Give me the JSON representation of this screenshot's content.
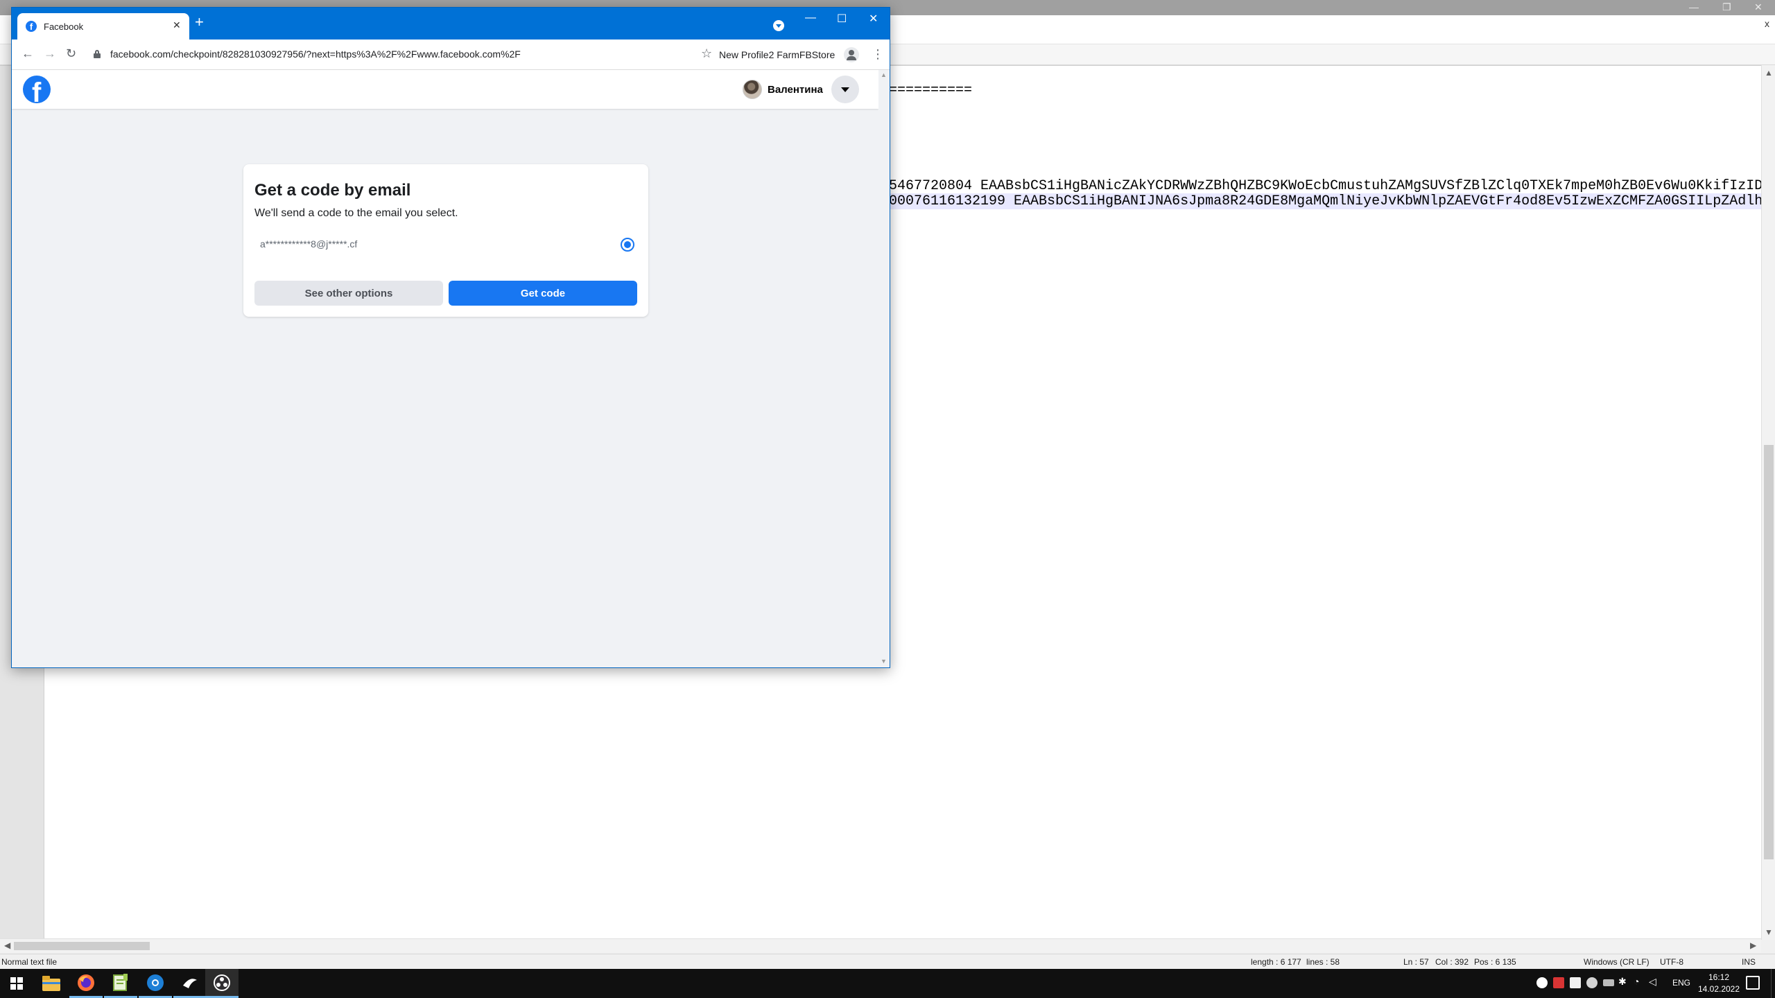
{
  "notepad": {
    "code_separator": "==========",
    "code_line_1": "5467720804 EAABsbCS1iHgBANicZAkYCDRWWzZBhQHZBC9KWoEcbCmustuhZAMgSUVSfZBlZClq0TXEk7mpeM0hZB0Ev6Wu0KkifIzID",
    "code_line_2": "00076116132199 EAABsbCS1iHgBANIJNA6sJpma8R24GDE8MgaMQmlNiyeJvKbWNlpZAEVGtFr4od8Ev5IzwExZCMFZA0GSIILpZAdlh",
    "doc_close": "x",
    "status": {
      "file_type": "Normal text file",
      "length": "length : 6 177",
      "lines": "lines : 58",
      "ln": "Ln : 57",
      "col": "Col : 392",
      "pos": "Pos : 6 135",
      "eol": "Windows (CR LF)",
      "encoding": "UTF-8",
      "mode": "INS"
    }
  },
  "browser": {
    "tab_title": "Facebook",
    "tab_close": "✕",
    "new_tab": "+",
    "url": "facebook.com/checkpoint/828281030927956/?next=https%3A%2F%2Fwww.facebook.com%2F",
    "bookmark_label": "New Profile2 FarmFBStore",
    "icons": {
      "back": "←",
      "forward": "→",
      "reload": "↻",
      "star": "☆",
      "menu": "⋮",
      "minimize": "—",
      "maximize": "☐",
      "close": "✕"
    }
  },
  "facebook": {
    "logo_letter": "f",
    "username": "Валентина",
    "card": {
      "title": "Get a code by email",
      "subtitle": "We'll send a code to the email you select.",
      "email_option": "a************8@j*****.cf",
      "secondary_button": "See other options",
      "primary_button": "Get code"
    },
    "brand_color": "#1877f2"
  },
  "taskbar": {
    "language": "ENG",
    "time": "16:12",
    "date": "14.02.2022",
    "apps": [
      "start",
      "file-explorer",
      "firefox",
      "notepad-plus-plus",
      "browser",
      "app",
      "obs"
    ]
  }
}
